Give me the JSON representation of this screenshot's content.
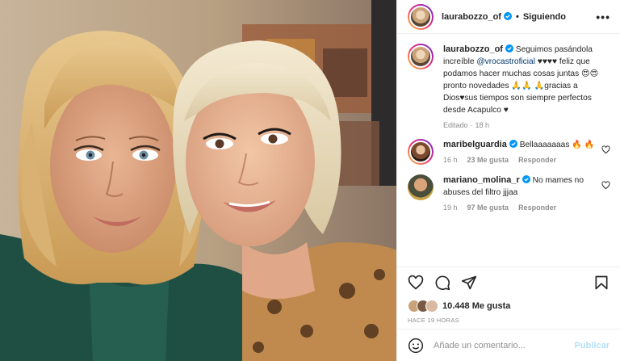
{
  "post": {
    "author": "laurabozzo_of",
    "follow_state": "Siguiendo",
    "more_label": "•••",
    "separator": "•",
    "caption": {
      "username": "laurabozzo_of",
      "text_before": " Seguimos pasándola increíble ",
      "mention": "@vrocastroficial",
      "text_after": " ♥♥♥♥ feliz que podamos hacer muchas cosas juntas 😍😍 pronto novedades 🙏🙏 🙏gracias a Dios♥sus tiempos son siempre perfectos desde Acapulco ♥",
      "edited": "Editado",
      "dot": "·",
      "age": "18 h"
    },
    "comments": [
      {
        "username": "maribelguardia",
        "text": " Bellaaaaaaas 🔥 🔥",
        "age": "16 h",
        "likes": "23 Me gusta",
        "reply": "Responder"
      },
      {
        "username": "mariano_molina_r",
        "text": " No mames no abuses del filtro jjjaa",
        "age": "19 h",
        "likes": "97 Me gusta",
        "reply": "Responder"
      }
    ],
    "likes_text": "10.448 Me gusta",
    "time_ago": "HACE 19 HORAS",
    "composer": {
      "placeholder": "Añade un comentario...",
      "publish_label": "Publicar"
    }
  },
  "colors": {
    "text": "#262626",
    "secondary": "#8e8e8e",
    "verified": "#0095f6",
    "mention": "#00376b",
    "publish_disabled": "#b2dffc"
  },
  "icons": {
    "like": "heart-icon",
    "comment": "comment-icon",
    "share": "share-icon",
    "save": "bookmark-icon",
    "emoji": "emoji-icon",
    "more": "more-options-icon",
    "verified": "verified-badge-icon"
  }
}
